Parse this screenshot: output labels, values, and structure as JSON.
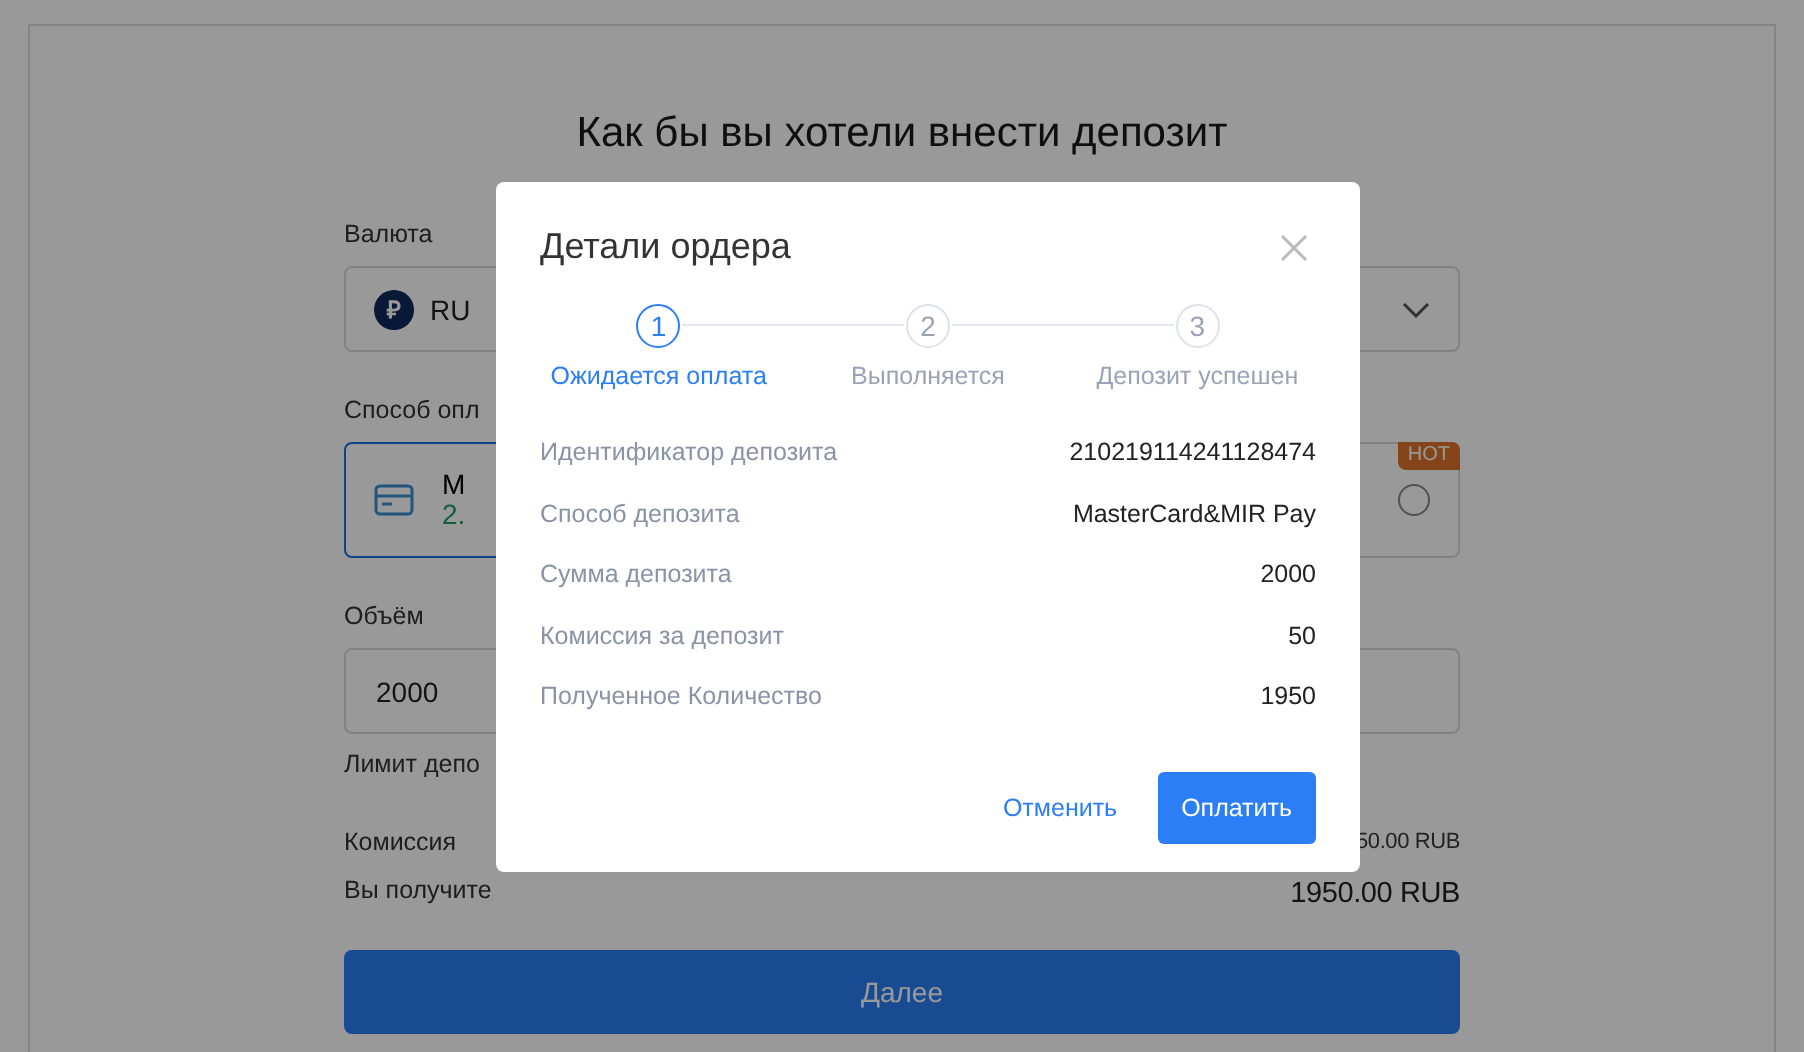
{
  "page": {
    "title": "Как бы вы хотели внести депозит",
    "currency": {
      "label": "Валюта",
      "symbol": "₽",
      "value": "RU"
    },
    "payment_method": {
      "label": "Способ опл",
      "options": [
        {
          "name": "M",
          "fee": "2.",
          "selected": true
        },
        {
          "badge": "HOT",
          "selected": false
        }
      ]
    },
    "amount": {
      "label": "Объём",
      "value": "2000",
      "limit": "Лимит депо"
    },
    "summary": [
      {
        "label": "Комиссия",
        "value": "50.00 RUB"
      },
      {
        "label": "Вы получите",
        "value": "1950.00 RUB"
      }
    ],
    "next_button": "Далее"
  },
  "dialog": {
    "title": "Детали ордера",
    "steps": [
      {
        "number": "1",
        "label": "Ожидается оплата",
        "selected": true
      },
      {
        "number": "2",
        "label": "Выполняется",
        "selected": false
      },
      {
        "number": "3",
        "label": "Депозит успешен",
        "selected": false
      }
    ],
    "rows": [
      {
        "label": "Идентификатор депозита",
        "value": "210219114241128474"
      },
      {
        "label": "Способ депозита",
        "value": "MasterCard&MIR Pay"
      },
      {
        "label": "Сумма депозита",
        "value": "2000"
      },
      {
        "label": "Комиссия за депозит",
        "value": "50"
      },
      {
        "label": "Полученное Количество",
        "value": "1950"
      }
    ],
    "cancel_button": "Отменить",
    "pay_button": "Оплатить"
  }
}
